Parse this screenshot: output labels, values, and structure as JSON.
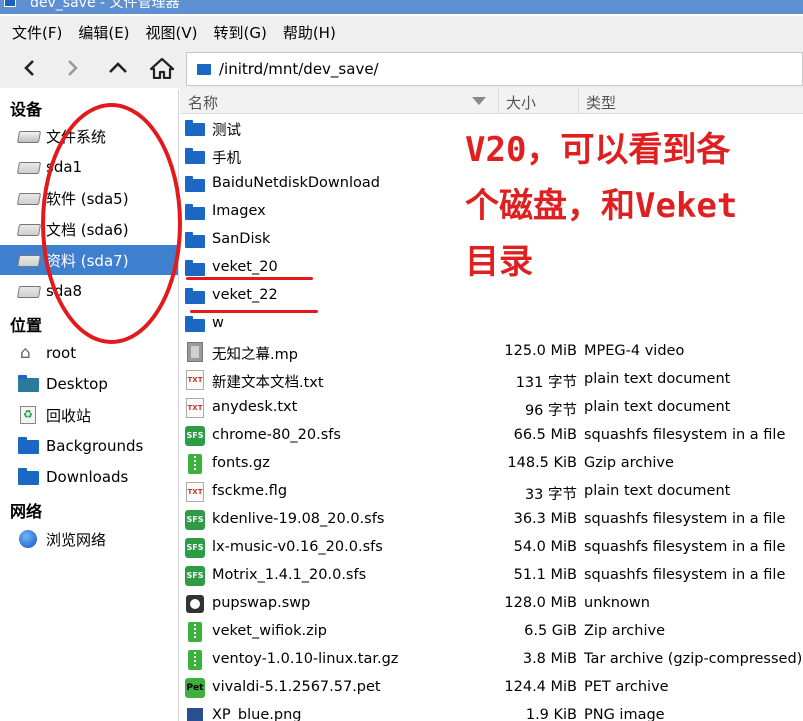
{
  "window": {
    "title": "dev_save - 文件管理器",
    "icon": "folder-icon"
  },
  "menubar": [
    "文件(F)",
    "编辑(E)",
    "视图(V)",
    "转到(G)",
    "帮助(H)"
  ],
  "toolbar": {
    "back_icon": "chevron-left-icon",
    "forward_icon": "chevron-right-icon",
    "up_icon": "chevron-up-icon",
    "home_icon": "home-icon"
  },
  "address": {
    "path": "/initrd/mnt/dev_save/"
  },
  "sidebar": {
    "devices_label": "设备",
    "devices": [
      {
        "label": "文件系统",
        "icon": "drive-icon"
      },
      {
        "label": "sda1",
        "icon": "drive-icon"
      },
      {
        "label": "软件 (sda5)",
        "icon": "drive-icon"
      },
      {
        "label": "文档 (sda6)",
        "icon": "drive-icon"
      },
      {
        "label": "资料 (sda7)",
        "icon": "drive-icon",
        "selected": true
      },
      {
        "label": "sda8",
        "icon": "drive-icon"
      }
    ],
    "places_label": "位置",
    "places": [
      {
        "label": "root",
        "icon": "home-icon"
      },
      {
        "label": "Desktop",
        "icon": "desktop-folder-icon"
      },
      {
        "label": "回收站",
        "icon": "trash-icon"
      },
      {
        "label": "Backgrounds",
        "icon": "folder-icon"
      },
      {
        "label": "Downloads",
        "icon": "folder-icon"
      }
    ],
    "network_label": "网络",
    "network": [
      {
        "label": "浏览网络",
        "icon": "globe-icon"
      }
    ]
  },
  "columns": {
    "name": "名称",
    "size": "大小",
    "type": "类型"
  },
  "files": [
    {
      "name": "测试",
      "size": "",
      "type": "",
      "icon": "folder"
    },
    {
      "name": "手机",
      "size": "",
      "type": "",
      "icon": "folder"
    },
    {
      "name": "BaiduNetdiskDownload",
      "size": "",
      "type": "",
      "icon": "folder"
    },
    {
      "name": "Imagex",
      "size": "",
      "type": "",
      "icon": "folder"
    },
    {
      "name": "SanDisk",
      "size": "",
      "type": "",
      "icon": "folder"
    },
    {
      "name": "veket_20",
      "size": "",
      "type": "",
      "icon": "folder"
    },
    {
      "name": "veket_22",
      "size": "",
      "type": "",
      "icon": "folder"
    },
    {
      "name": "w",
      "size": "",
      "type": "",
      "icon": "folder"
    },
    {
      "name": "无知之幕.mp",
      "size": "125.0 MiB",
      "type": "MPEG-4 video",
      "icon": "video"
    },
    {
      "name": "新建文本文档.txt",
      "size": "131 字节",
      "type": "plain text document",
      "icon": "txt"
    },
    {
      "name": "anydesk.txt",
      "size": "96 字节",
      "type": "plain text document",
      "icon": "txt"
    },
    {
      "name": "chrome-80_20.sfs",
      "size": "66.5 MiB",
      "type": "squashfs filesystem in a file",
      "icon": "sfs"
    },
    {
      "name": "fonts.gz",
      "size": "148.5 KiB",
      "type": "Gzip archive",
      "icon": "zip"
    },
    {
      "name": "fsckme.flg",
      "size": "33 字节",
      "type": "plain text document",
      "icon": "txt"
    },
    {
      "name": "kdenlive-19.08_20.0.sfs",
      "size": "36.3 MiB",
      "type": "squashfs filesystem in a file",
      "icon": "sfs"
    },
    {
      "name": "lx-music-v0.16_20.0.sfs",
      "size": "54.0 MiB",
      "type": "squashfs filesystem in a file",
      "icon": "sfs"
    },
    {
      "name": "Motrix_1.4.1_20.0.sfs",
      "size": "51.1 MiB",
      "type": "squashfs filesystem in a file",
      "icon": "sfs"
    },
    {
      "name": "pupswap.swp",
      "size": "128.0 MiB",
      "type": "unknown",
      "icon": "swap"
    },
    {
      "name": "veket_wifiok.zip",
      "size": "6.5 GiB",
      "type": "Zip archive",
      "icon": "zip"
    },
    {
      "name": "ventoy-1.0.10-linux.tar.gz",
      "size": "3.8 MiB",
      "type": "Tar archive (gzip-compressed)",
      "icon": "zip"
    },
    {
      "name": "vivaldi-5.1.2567.57.pet",
      "size": "124.4 MiB",
      "type": "PET archive",
      "icon": "pet"
    },
    {
      "name": "XP_blue.png",
      "size": "1.9 KiB",
      "type": "PNG image",
      "icon": "png"
    }
  ],
  "icon_text": {
    "txt": "TXT",
    "sfs": "SFS",
    "pet": "Pet"
  },
  "annotation": {
    "line1": "V20，可以看到各",
    "line2": "个磁盘，和Veket",
    "line3": "目录",
    "color": "#e3191c"
  }
}
